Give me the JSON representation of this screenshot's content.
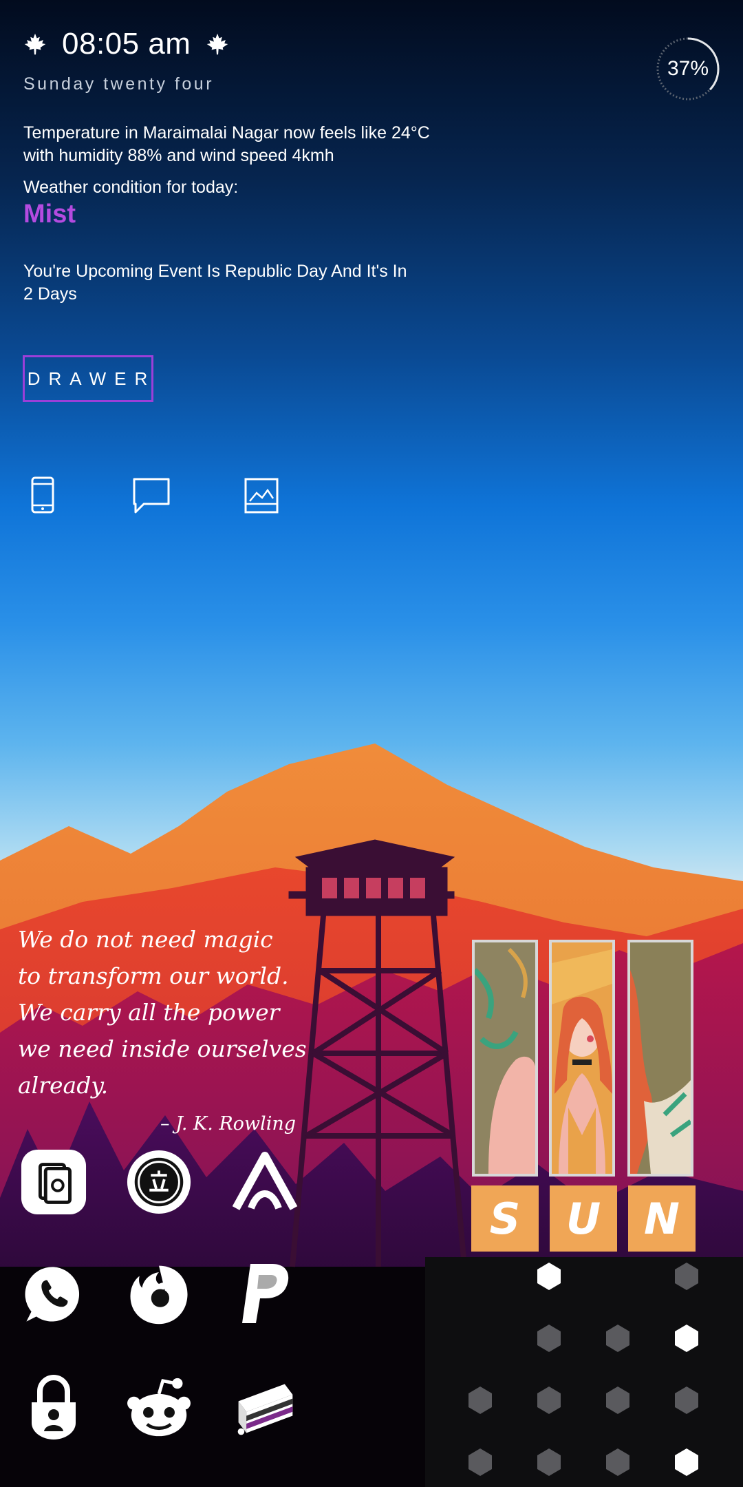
{
  "clock": {
    "time": "08:05 am",
    "date": "Sunday twenty four"
  },
  "battery": {
    "percent_label": "37%",
    "level": 0.37
  },
  "weather": {
    "line": "Temperature in Maraimalai Nagar now feels like 24°C with humidity 88% and wind speed 4kmh",
    "condition_label": "Weather condition for today:",
    "condition": "Mist",
    "condition_color": "#b44be0"
  },
  "event": {
    "text": "You're Upcoming Event Is Republic Day And It's In 2 Days"
  },
  "drawer": {
    "label": "DRAWER",
    "border_color": "#9b3fd8"
  },
  "quick_icons": [
    "phone-icon",
    "message-icon",
    "gallery-icon"
  ],
  "quote": {
    "lines": [
      "We do not need magic",
      "to transform our world.",
      "We carry all the power",
      "we need inside ourselves",
      "already."
    ],
    "author": "– J. K. Rowling"
  },
  "apps": [
    {
      "name": "notebook-app-icon"
    },
    {
      "name": "stamp-app-icon"
    },
    {
      "name": "arc-app-icon"
    },
    {
      "name": "whatsapp-icon"
    },
    {
      "name": "firefox-icon"
    },
    {
      "name": "paypal-icon"
    },
    {
      "name": "lock-app-icon"
    },
    {
      "name": "reddit-icon"
    },
    {
      "name": "cake-app-icon"
    }
  ],
  "sun_widget": {
    "letters": [
      "S",
      "U",
      "N"
    ],
    "tile_color": "#f0a656"
  },
  "hex_grid": {
    "rows": [
      [
        null,
        "white",
        null,
        "gray"
      ],
      [
        null,
        "gray",
        "gray",
        "white"
      ],
      [
        "gray",
        "gray",
        "gray",
        "gray"
      ],
      [
        "gray",
        "gray",
        "gray",
        "white"
      ]
    ]
  }
}
